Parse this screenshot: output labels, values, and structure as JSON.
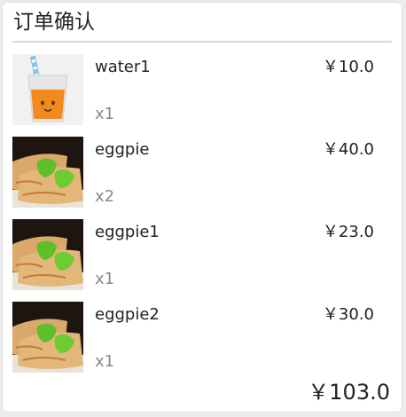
{
  "header": {
    "title": "订单确认"
  },
  "items": [
    {
      "name": "water1",
      "price": "￥10.0",
      "qty": "x1",
      "image": "juice-cup-image"
    },
    {
      "name": "eggpie",
      "price": "￥40.0",
      "qty": "x2",
      "image": "egg-pie-image"
    },
    {
      "name": "eggpie1",
      "price": "￥23.0",
      "qty": "x1",
      "image": "egg-pie-image"
    },
    {
      "name": "eggpie2",
      "price": "￥30.0",
      "qty": "x1",
      "image": "egg-pie-image"
    }
  ],
  "summary": {
    "total": "￥103.0"
  },
  "colors": {
    "background": "#ececec",
    "card": "#ffffff",
    "text": "#222222",
    "muted": "#888888",
    "divider": "#d9d9d9"
  }
}
